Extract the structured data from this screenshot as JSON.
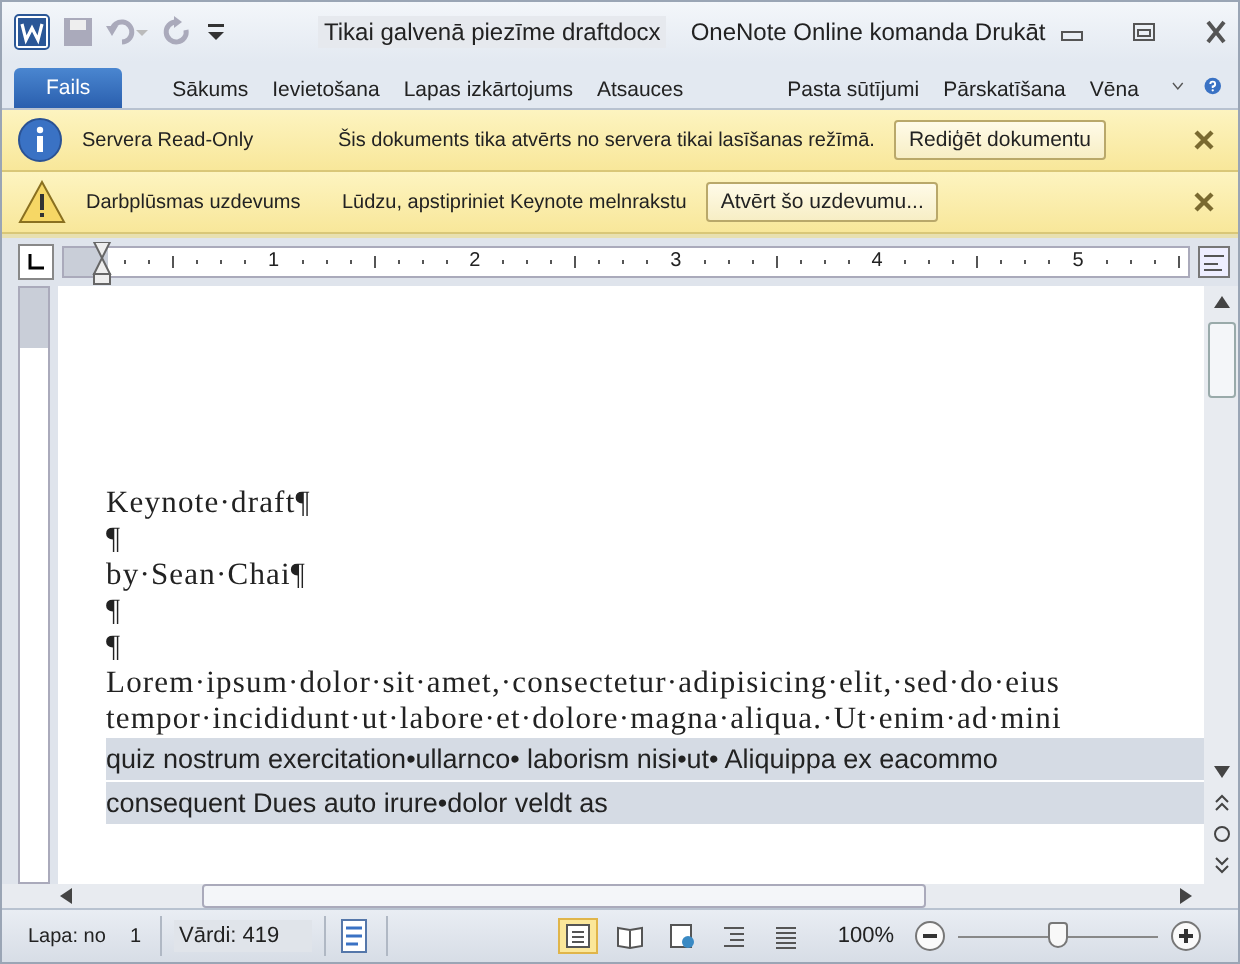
{
  "window": {
    "title": "Tikai galvenā piezīme draftdocx",
    "app_title": "OneNote Online komanda Drukāt"
  },
  "ribbon_tabs": [
    {
      "label": "Fails",
      "selected": true
    },
    {
      "label": "Sākums",
      "selected": false
    },
    {
      "label": "Ievietošana",
      "selected": false
    },
    {
      "label": "Lapas izkārtojums",
      "selected": false
    },
    {
      "label": "Atsauces",
      "selected": false
    },
    {
      "label": "Pasta sūtījumi",
      "selected": false
    },
    {
      "label": "Pārskatīšana",
      "selected": false
    },
    {
      "label": "Vēna",
      "selected": false
    }
  ],
  "message_bars": [
    {
      "kind": "info",
      "title": "Servera Read-Only",
      "message": "Šis dokuments tika atvērts no servera tikai lasīšanas režīmā.",
      "button": "Rediģēt dokumentu"
    },
    {
      "kind": "warning",
      "title": "Darbplūsmas uzdevums",
      "message": "Lūdzu, apstipriniet Keynote melnrakstu",
      "button": "Atvērt šo uzdevumu..."
    }
  ],
  "ruler": {
    "numbers": [
      "1",
      "2",
      "3",
      "4",
      "5"
    ]
  },
  "document": {
    "paragraphs": [
      {
        "text": "Keynote·draft¶",
        "highlighted": false
      },
      {
        "text": "¶",
        "highlighted": false
      },
      {
        "text": "by·Sean·Chai¶",
        "highlighted": false
      },
      {
        "text": "¶",
        "highlighted": false
      },
      {
        "text": "¶",
        "highlighted": false
      },
      {
        "text": "Lorem·ipsum·dolor·sit·amet,·consectetur·adipisicing·elit,·sed·do·eius",
        "highlighted": false
      },
      {
        "text": "tempor·incididunt·ut·labore·et·dolore·magna·aliqua.·Ut·enim·ad·mini",
        "highlighted": false
      },
      {
        "text": "quiz nostrum exercitation•ullarnco• laborism nisi•ut• Aliquippa ex eacommo",
        "highlighted": true
      },
      {
        "text": "consequent Dues auto irure•dolor veldt as",
        "highlighted": true
      }
    ]
  },
  "status_bar": {
    "page_label": "Lapa: no",
    "page_number": "1",
    "words": "Vārdi: 419",
    "zoom": "100%",
    "zoom_slider": {
      "level": 0.5
    },
    "view_buttons": [
      {
        "kind": "print",
        "selected": true
      },
      {
        "kind": "reading",
        "selected": false
      },
      {
        "kind": "web",
        "selected": false
      },
      {
        "kind": "outline",
        "selected": false
      },
      {
        "kind": "draft",
        "selected": false
      }
    ]
  }
}
